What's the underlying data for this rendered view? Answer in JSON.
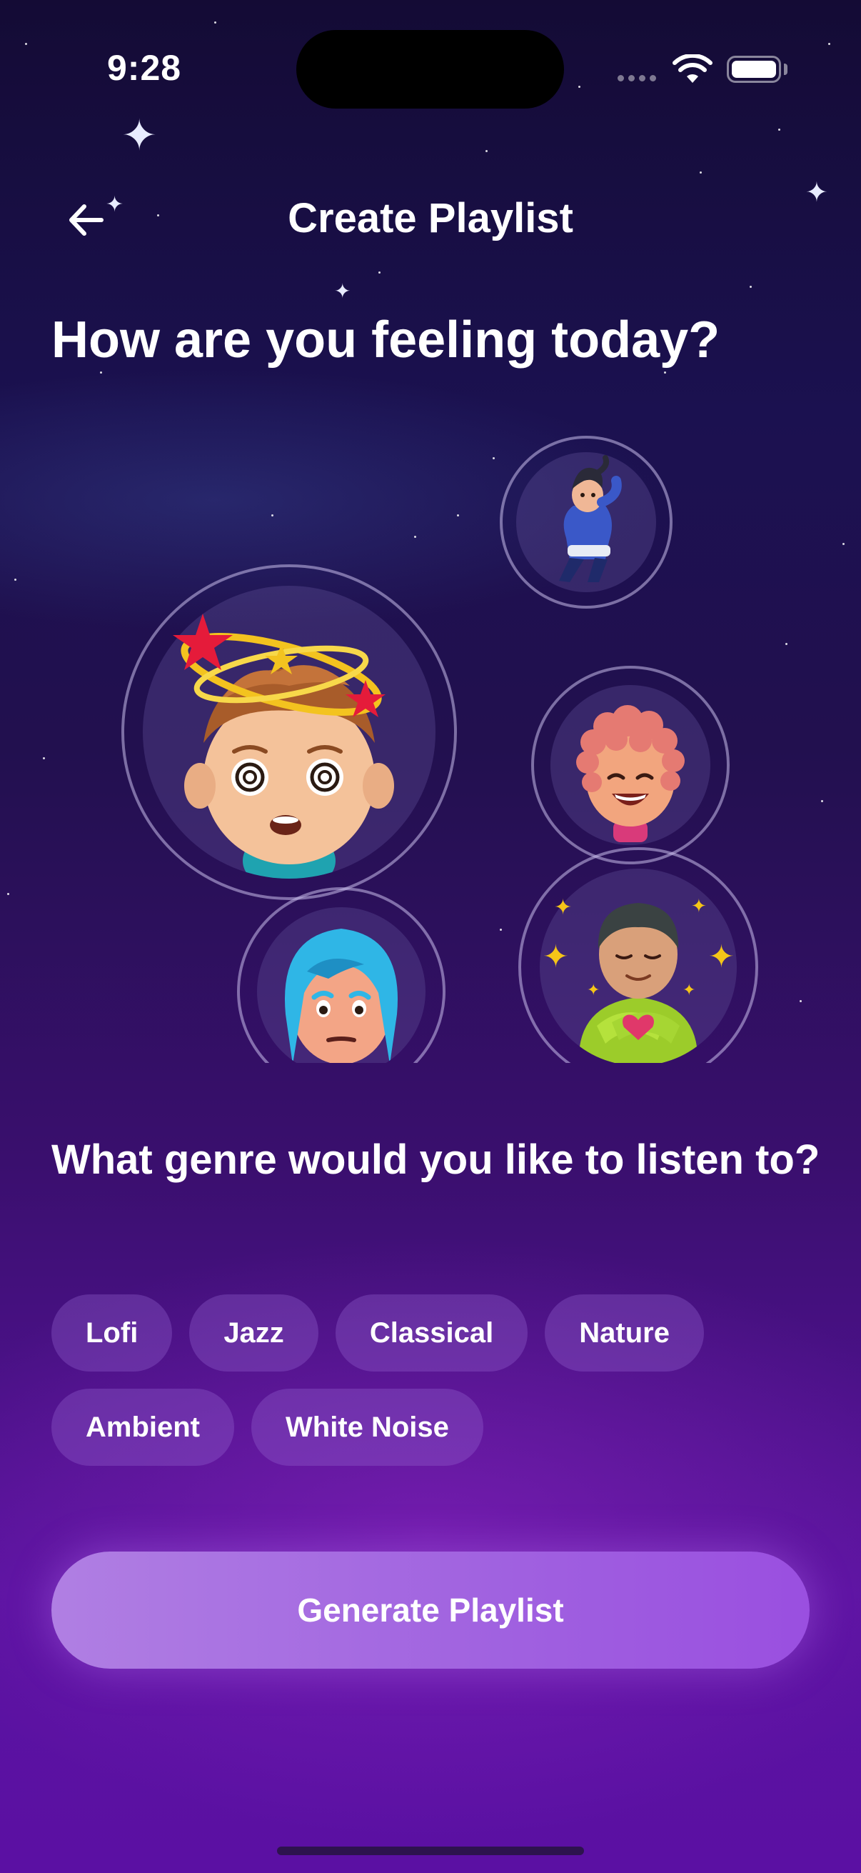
{
  "status_bar": {
    "time": "9:28"
  },
  "header": {
    "title": "Create Playlist",
    "back_icon": "arrow-left-icon"
  },
  "mood_section": {
    "heading": "How are you feeling today?",
    "moods": [
      {
        "id": "dizzy",
        "icon": "dizzy-avatar"
      },
      {
        "id": "relaxed",
        "icon": "relaxed-floating-avatar"
      },
      {
        "id": "happy",
        "icon": "laughing-curly-hair-avatar"
      },
      {
        "id": "worried",
        "icon": "worried-blue-hair-avatar"
      },
      {
        "id": "grateful",
        "icon": "grateful-heart-avatar"
      }
    ]
  },
  "genre_section": {
    "heading": "What genre would you like to listen to?",
    "genres": [
      "Lofi",
      "Jazz",
      "Classical",
      "Nature",
      "Ambient",
      "White Noise"
    ]
  },
  "primary_action": {
    "label": "Generate Playlist"
  },
  "colors": {
    "background_top": "#140b35",
    "background_bottom": "#5b10a3",
    "chip_background": "#7a4fb0",
    "button_start": "#b07fe3",
    "button_end": "#9a4fe0"
  }
}
